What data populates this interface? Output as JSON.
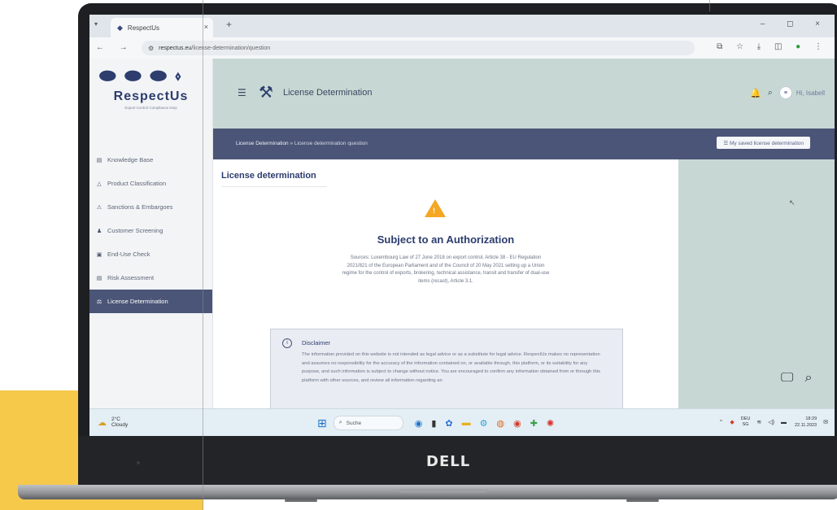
{
  "browser": {
    "tab_title": "RespectUs",
    "tab_close": "×",
    "new_tab": "+",
    "window_controls": "–  ◻  ×",
    "nav_buttons": "←  →  ↻",
    "url_host": "respectus.eu",
    "url_path": "/license-determination/question",
    "extensions": "⧉ ☆ ⤓ ◫"
  },
  "sidebar": {
    "brand": "RespectUs",
    "tagline": "Export Control Compliance Duty",
    "items": [
      {
        "label": "Knowledge Base",
        "icon": "book-icon",
        "glyph": "▤"
      },
      {
        "label": "Product Classification",
        "icon": "tag-icon",
        "glyph": "△"
      },
      {
        "label": "Sanctions & Embargoes",
        "icon": "warning-icon",
        "glyph": "⚠"
      },
      {
        "label": "Customer Screening",
        "icon": "users-icon",
        "glyph": "♟"
      },
      {
        "label": "End-Use Check",
        "icon": "clipboard-icon",
        "glyph": "▣"
      },
      {
        "label": "Risk Assessment",
        "icon": "document-icon",
        "glyph": "▤"
      },
      {
        "label": "License Determination",
        "icon": "gavel-icon",
        "glyph": "⚖"
      }
    ],
    "active_index": 6
  },
  "header": {
    "title": "License Determination",
    "greeting": "Hi, Isabell",
    "avatar_letter": "≡"
  },
  "breadcrumb": {
    "root": "License Determination",
    "separator": " » ",
    "current": "License determination question",
    "saved_button": "☰ My saved license determination"
  },
  "main": {
    "title": "License determination",
    "result_title": "Subject to an Authorization",
    "sources": "Sources: Luxembourg Law of 27 June 2018 on export control, Article 38 - EU Regulation 2021/821 of the European Parliament and of the Council of 20 May 2021 setting up a Union regime for the control of exports, brokering, technical assistance, transit and transfer of dual-use items (recast), Article 3.1.",
    "disclaimer_title": "Disclaimer",
    "disclaimer_text": "The information provided on this website is not intended as legal advice or as a substitute for legal advice. RespectUs makes no representation and assumes no responsibility for the accuracy of the information contained on, or available through, this platform, or its suitability for any purpose, and such information is subject to change without notice. You are encouraged to confirm any information obtained from or through this platform with other sources, and review all information regarding an"
  },
  "taskbar": {
    "temperature": "2°C",
    "weather": "Cloudy",
    "search_label": "Suche",
    "lang": "DEU",
    "lang2": "SG",
    "time": "18:29",
    "date": "22.11.2023"
  },
  "hardware": {
    "brand_logo": "DELL"
  },
  "colors": {
    "accent_navy": "#4a5577",
    "header_teal": "#c7d8d4",
    "warning": "#f5a623",
    "brand_blue": "#2c3d6e",
    "background_yellow": "#f6c94b"
  }
}
